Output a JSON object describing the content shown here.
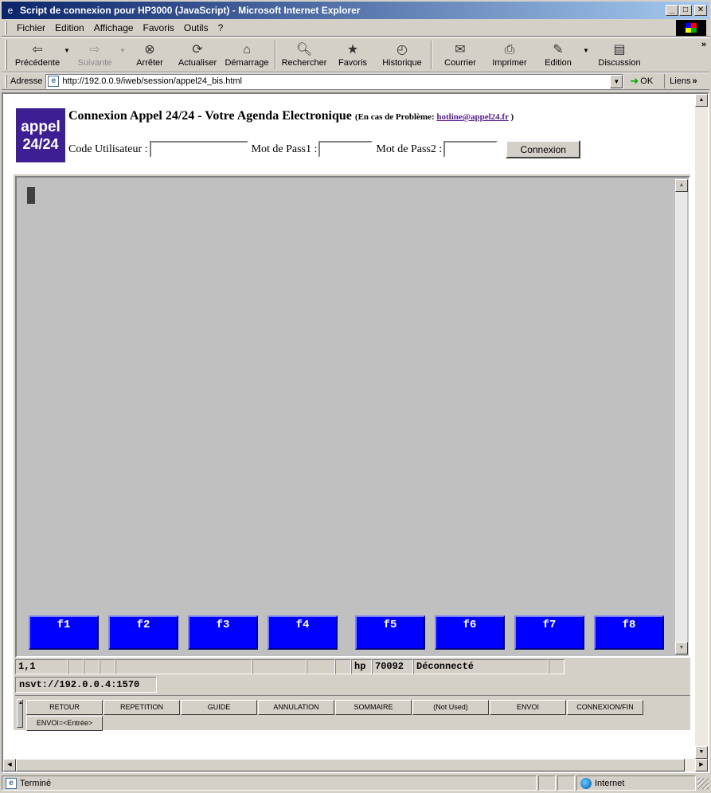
{
  "window": {
    "title": "Script de connexion pour HP3000 (JavaScript) - Microsoft Internet Explorer",
    "minimize": "_",
    "maximize": "□",
    "close": "✕"
  },
  "menu": {
    "items": [
      {
        "label": "Fichier"
      },
      {
        "label": "Edition"
      },
      {
        "label": "Affichage"
      },
      {
        "label": "Favoris"
      },
      {
        "label": "Outils"
      },
      {
        "label": "?"
      }
    ]
  },
  "toolbar": {
    "back": "Précédente",
    "forward": "Suivante",
    "stop": "Arrêter",
    "refresh": "Actualiser",
    "home": "Démarrage",
    "search": "Rechercher",
    "favorites": "Favoris",
    "history": "Historique",
    "mail": "Courrier",
    "print": "Imprimer",
    "edit": "Edition",
    "discuss": "Discussion",
    "more": "»"
  },
  "address": {
    "label": "Adresse",
    "url": "http://192.0.0.9/iweb/session/appel24_bis.html",
    "go": "OK",
    "links": "Liens",
    "more": "»"
  },
  "page": {
    "logo_line1": "appel",
    "logo_line2": "24/24",
    "heading": "Connexion Appel 24/24 - Votre Agenda Electronique",
    "help_prefix": "(En cas de Problème:",
    "help_email": "hotline@appel24.fr",
    "help_suffix": ")",
    "user_label": "Code Utilisateur :",
    "user_value": "",
    "pass1_label": "Mot de Pass1 :",
    "pass1_value": "",
    "pass2_label": "Mot de Pass2 :",
    "pass2_value": "",
    "connect_button": "Connexion"
  },
  "terminal": {
    "fkeys": [
      "f1",
      "f2",
      "f3",
      "f4",
      "f5",
      "f6",
      "f7",
      "f8"
    ],
    "status": {
      "position": "1,1",
      "mode": "hp",
      "code": "70092",
      "state": "Déconnecté"
    },
    "host": "nsvt://192.0.0.4:1570",
    "buttons": [
      "RETOUR",
      "REPETITION",
      "GUIDE",
      "ANNULATION",
      "SOMMAIRE",
      "(Not Used)",
      "ENVOI",
      "CONNEXION/FIN"
    ],
    "enter_button": "ENVOI=<Entrée>"
  },
  "statusbar": {
    "text": "Terminé",
    "zone": "Internet"
  },
  "colors": {
    "titlebar_start": "#0a246a",
    "logo_bg": "#3d1f93",
    "fkey_bg": "#0000ff",
    "link": "#551a8b"
  }
}
